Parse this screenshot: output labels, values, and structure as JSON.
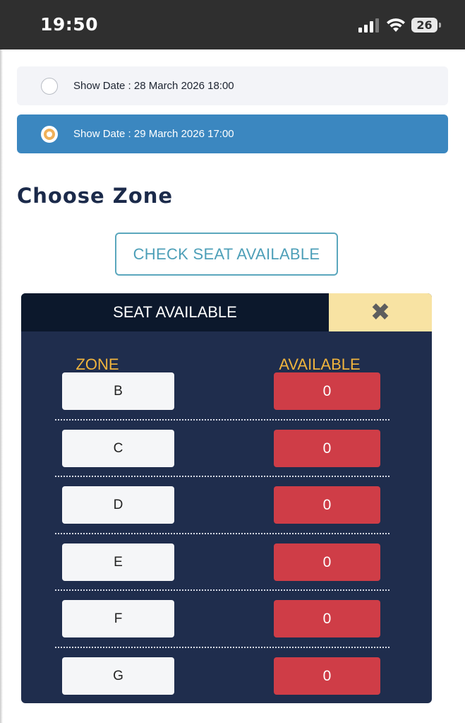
{
  "status_bar": {
    "time": "19:50",
    "battery_level": "26",
    "icons": [
      "signal-icon",
      "wifi-icon",
      "battery-icon"
    ]
  },
  "show_dates": [
    {
      "label": "Show Date : 28 March 2026 18:00",
      "selected": false
    },
    {
      "label": "Show Date : 29 March 2026 17:00",
      "selected": true
    }
  ],
  "heading": "Choose Zone",
  "check_button": "CHECK SEAT AVAILABLE",
  "panel": {
    "title": "SEAT AVAILABLE",
    "close_icon": "close-icon",
    "zone_header": "ZONE",
    "available_header": "AVAILABLE",
    "rows": [
      {
        "zone": "B",
        "available": "0"
      },
      {
        "zone": "C",
        "available": "0"
      },
      {
        "zone": "D",
        "available": "0"
      },
      {
        "zone": "E",
        "available": "0"
      },
      {
        "zone": "F",
        "available": "0"
      },
      {
        "zone": "G",
        "available": "0"
      }
    ]
  },
  "colors": {
    "selected_date": "#3b87c0",
    "panel_bg": "#1f2d4d",
    "header_bg": "#0c182c",
    "close_bg": "#f8e3a3",
    "column_header": "#f0b43d",
    "available_bg": "#cf3d47",
    "heading": "#1b2a4a"
  }
}
